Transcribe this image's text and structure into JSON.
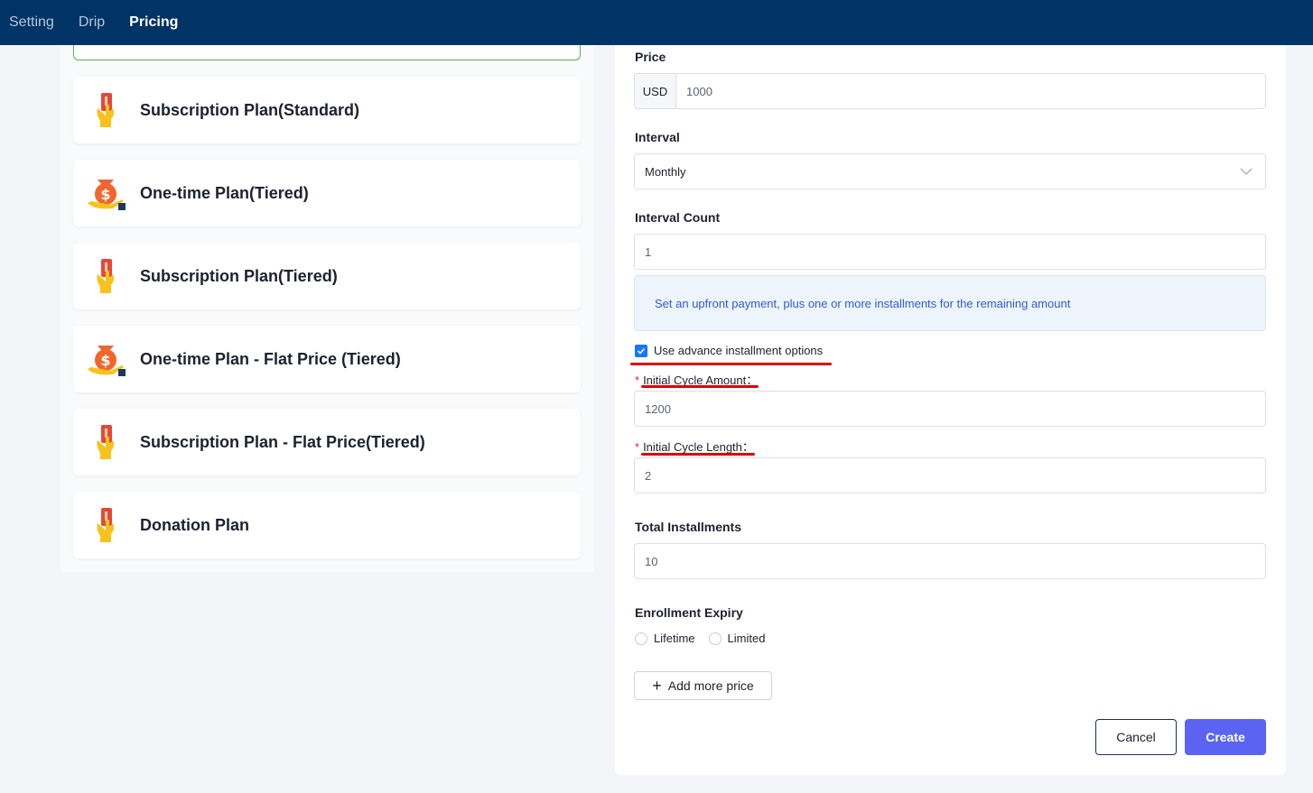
{
  "topbar": {
    "tabs": [
      {
        "label": "Setting"
      },
      {
        "label": "Drip"
      },
      {
        "label": "Pricing"
      }
    ]
  },
  "plans": [
    {
      "label": "Subscription Plan(Standard)",
      "icon": "card-hand-icon"
    },
    {
      "label": "One-time Plan(Tiered)",
      "icon": "money-bag-icon"
    },
    {
      "label": "Subscription Plan(Tiered)",
      "icon": "card-hand-icon"
    },
    {
      "label": "One-time Plan - Flat Price (Tiered)",
      "icon": "money-bag-icon"
    },
    {
      "label": "Subscription Plan - Flat Price(Tiered)",
      "icon": "card-hand-icon"
    },
    {
      "label": "Donation Plan",
      "icon": "card-hand-icon"
    }
  ],
  "form": {
    "price": {
      "label": "Price",
      "currency": "USD",
      "value": "1000"
    },
    "interval": {
      "label": "Interval",
      "value": "Monthly"
    },
    "interval_count": {
      "label": "Interval Count",
      "value": "1"
    },
    "info_text": "Set an upfront payment, plus one or more installments for the remaining amount",
    "advance_option": {
      "label": "Use advance installment options",
      "checked": true
    },
    "initial_cycle_amount": {
      "label": "Initial Cycle Amount",
      "colon": "：",
      "value": "1200"
    },
    "initial_cycle_length": {
      "label": "Initial Cycle Length",
      "colon": "：",
      "value": "2"
    },
    "total_installments": {
      "label": "Total Installments",
      "value": "10"
    },
    "enrollment_expiry": {
      "label": "Enrollment Expiry",
      "options": [
        {
          "label": "Lifetime"
        },
        {
          "label": "Limited"
        }
      ]
    },
    "add_more_price": "Add more price",
    "cancel": "Cancel",
    "create": "Create"
  },
  "colors": {
    "topbar": "#003366",
    "accent": "#5b63f2",
    "checkbox": "#1677ff",
    "annotation": "#e00000"
  }
}
